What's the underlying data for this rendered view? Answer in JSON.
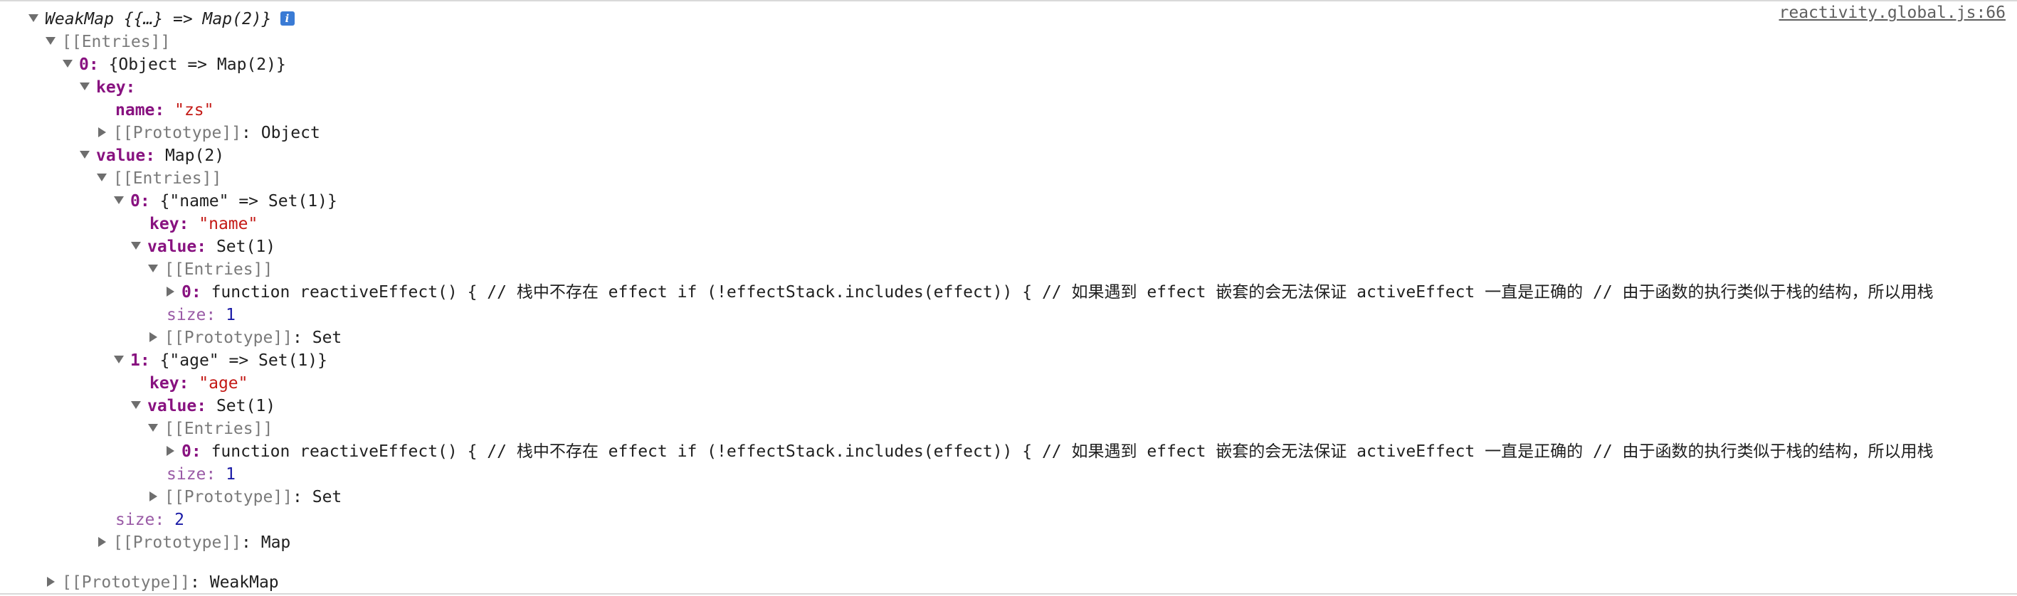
{
  "source_link": "reactivity.global.js:66",
  "rows": [
    {
      "text": "WeakMap {{…} => Map(2)}"
    },
    {
      "text": "[[Entries]]"
    },
    {
      "key": "0",
      "text": "{Object => Map(2)}"
    },
    {
      "key": "key",
      "text": ""
    },
    {
      "key": "name",
      "text": "\"zs\""
    },
    {
      "key": "[[Prototype]]",
      "text": "Object"
    },
    {
      "key": "value",
      "text": "Map(2)"
    },
    {
      "text": "[[Entries]]"
    },
    {
      "key": "0",
      "text": "{\"name\" => Set(1)}"
    },
    {
      "key": "key",
      "text": "\"name\""
    },
    {
      "key": "value",
      "text": "Set(1)"
    },
    {
      "text": "[[Entries]]"
    },
    {
      "key": "0",
      "text": "function reactiveEffect() { // 栈中不存在 effect if (!effectStack.includes(effect)) { // 如果遇到 effect 嵌套的会无法保证 activeEffect 一直是正确的 // 由于函数的执行类似于栈的结构，所以用栈"
    },
    {
      "key": "size",
      "text": "1"
    },
    {
      "key": "[[Prototype]]",
      "text": "Set"
    },
    {
      "key": "1",
      "text": "{\"age\" => Set(1)}"
    },
    {
      "key": "key",
      "text": "\"age\""
    },
    {
      "key": "value",
      "text": "Set(1)"
    },
    {
      "text": "[[Entries]]"
    },
    {
      "key": "0",
      "text": "function reactiveEffect() { // 栈中不存在 effect if (!effectStack.includes(effect)) { // 如果遇到 effect 嵌套的会无法保证 activeEffect 一直是正确的 // 由于函数的执行类似于栈的结构，所以用栈"
    },
    {
      "key": "size",
      "text": "1"
    },
    {
      "key": "[[Prototype]]",
      "text": "Set"
    },
    {
      "key": "size",
      "text": "2"
    },
    {
      "key": "[[Prototype]]",
      "text": "Map"
    },
    {
      "key": "[[Prototype]]",
      "text": "WeakMap"
    }
  ],
  "colors": {
    "key": "#881280",
    "key_light": "#9a5ba6",
    "string": "#c41a16",
    "number": "#1a1aa6",
    "gray": "#7a7a7a",
    "info_badge": "#3a7bd5"
  },
  "icons": {
    "info": "info-icon",
    "expanded": "triangle-down-icon",
    "collapsed": "triangle-right-icon"
  },
  "info_glyph": "i"
}
